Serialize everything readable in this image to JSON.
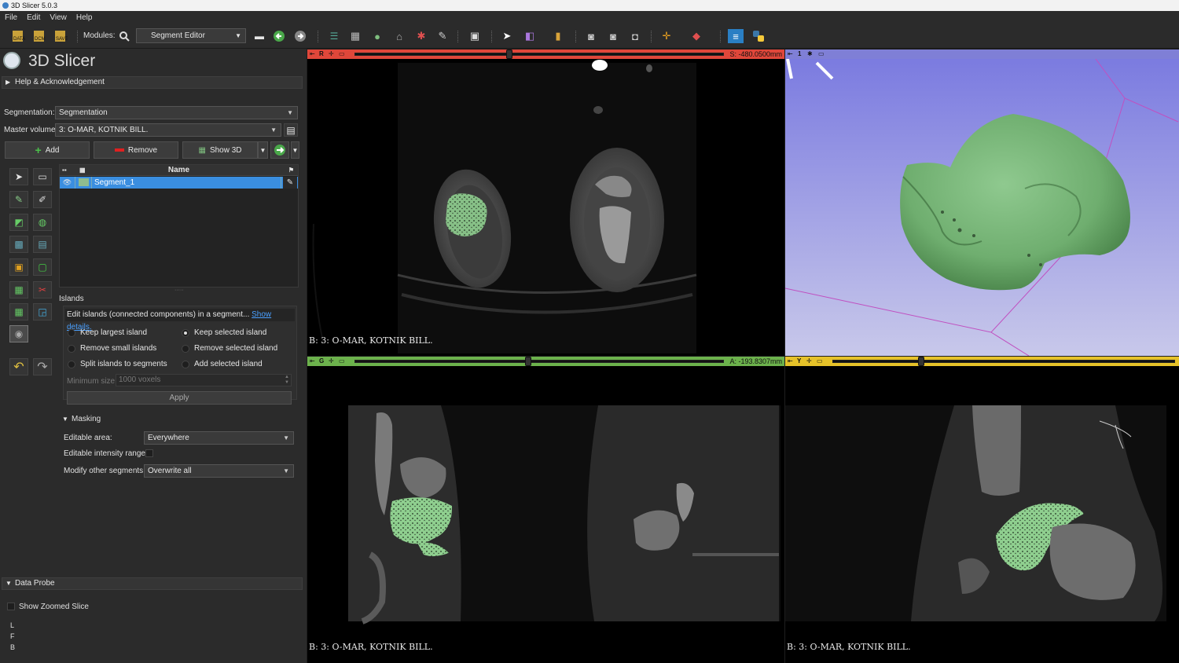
{
  "window": {
    "title": "3D Slicer 5.0.3"
  },
  "menu": [
    "File",
    "Edit",
    "View",
    "Help"
  ],
  "toolbar": {
    "modules_label": "Modules:",
    "module_selected": "Segment Editor",
    "icons": [
      "data-icon",
      "dcm-icon",
      "save-icon",
      "search-icon",
      "back-icon",
      "forward-icon",
      "layout-icon",
      "volume-icon",
      "model-icon",
      "transform-icon",
      "markups-icon",
      "segment-icon",
      "screenshot-icon",
      "crosshair-icon",
      "python-icon"
    ]
  },
  "panel": {
    "app_name": "3D Slicer",
    "help_section": "Help & Acknowledgement",
    "segmentation_label": "Segmentation:",
    "segmentation_value": "Segmentation",
    "master_volume_label": "Master volume:",
    "master_volume_value": "3: O-MAR, KOTNIK BILL.",
    "add_label": "Add",
    "remove_label": "Remove",
    "show3d_label": "Show 3D",
    "table_header_name": "Name",
    "segments": [
      {
        "name": "Segment_1",
        "color": "#8fbc8f"
      }
    ],
    "effect_name": "Islands",
    "effect_help": "Edit islands (connected components) in a segment...",
    "show_details": "Show details.",
    "options": [
      {
        "label": "Keep largest island",
        "selected": false
      },
      {
        "label": "Keep selected island",
        "selected": true
      },
      {
        "label": "Remove small islands",
        "selected": false
      },
      {
        "label": "Remove selected island",
        "selected": false
      },
      {
        "label": "Split islands to segments",
        "selected": false
      },
      {
        "label": "Add selected island",
        "selected": false
      }
    ],
    "min_size_label": "Minimum size:",
    "min_size_value": "1000 voxels",
    "apply_label": "Apply",
    "masking_section": "Masking",
    "editable_area_label": "Editable area:",
    "editable_area_value": "Everywhere",
    "intensity_label": "Editable intensity range:",
    "modify_label": "Modify other segments:",
    "modify_value": "Overwrite all",
    "data_probe_section": "Data Probe",
    "show_zoomed": "Show Zoomed Slice",
    "probe_lines": [
      "L",
      "F",
      "B"
    ]
  },
  "views": {
    "red": {
      "letter": "R",
      "offset": "S: -480.0500mm",
      "caption": "B: 3: O-MAR, KOTNIK BILL.",
      "color": "#e0473a",
      "slider_fraction": 0.42
    },
    "threed": {
      "label": "1",
      "color": "#7f7fd6"
    },
    "green": {
      "letter": "G",
      "offset": "A: -193.8307mm",
      "caption": "B: 3: O-MAR, KOTNIK BILL.",
      "color": "#6cb24c",
      "slider_fraction": 0.47
    },
    "yellow": {
      "letter": "Y",
      "caption": "B: 3: O-MAR, KOTNIK BILL.",
      "color": "#e6c229",
      "slider_fraction": 0.26
    }
  },
  "colors": {
    "segment_green": "#7fbf7f",
    "bg3d_top": "#7b7be0",
    "bg3d_bottom": "#c8c8ea"
  }
}
